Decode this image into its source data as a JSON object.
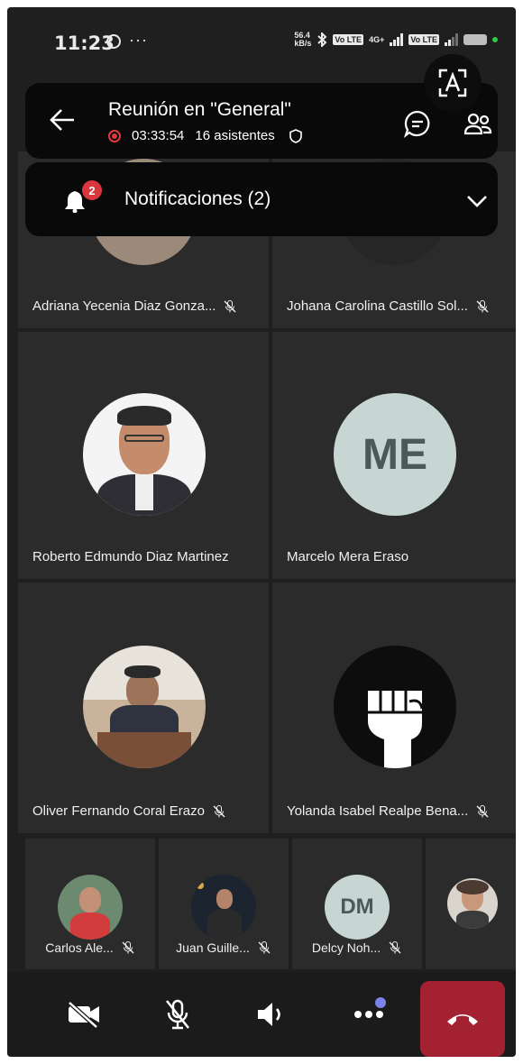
{
  "status_bar": {
    "time": "11:23",
    "speed_top": "56.4",
    "speed_bottom": "kB/s",
    "sim_tag": "4G+",
    "volte1": "Vo LTE",
    "volte2": "Vo LTE"
  },
  "header": {
    "title": "Reunión en \"General\"",
    "duration": "03:33:54",
    "attendees": "16 asistentes"
  },
  "notifications": {
    "label": "Notificaciones (2)",
    "badge_count": "2"
  },
  "participants": [
    {
      "name": "Adriana Yecenia Diaz Gonza...",
      "muted": true
    },
    {
      "name": "Johana Carolina Castillo Sol...",
      "muted": true
    },
    {
      "name": "Roberto Edmundo Diaz Martinez",
      "muted": false
    },
    {
      "name": "Marcelo  Mera Eraso",
      "initials": "ME",
      "muted": false
    },
    {
      "name": "Oliver Fernando Coral Erazo",
      "muted": true
    },
    {
      "name": "Yolanda Isabel Realpe Bena...",
      "muted": true
    }
  ],
  "small_participants": [
    {
      "name": "Carlos Ale...",
      "muted": true
    },
    {
      "name": "Juan Guille...",
      "muted": true
    },
    {
      "name": "Delcy Noh...",
      "initials": "DM",
      "muted": true
    },
    {
      "name": "",
      "muted": false
    }
  ],
  "colors": {
    "background": "#1f1f1f",
    "tile": "#2b2b2b",
    "hangup": "#a42132",
    "record_red": "#e23b3b",
    "badge_red": "#d9363e",
    "initials_bg": "#c8d6d3",
    "accent_purple": "#7b83eb"
  },
  "icons": [
    "whatsapp-icon",
    "bluetooth-icon",
    "back-arrow-icon",
    "record-icon",
    "shield-icon",
    "chat-icon",
    "participants-icon",
    "bell-icon",
    "chevron-down-icon",
    "mic-off-icon",
    "camera-off-icon",
    "speaker-icon",
    "more-icon",
    "hang-up-icon",
    "google-lens-icon"
  ]
}
